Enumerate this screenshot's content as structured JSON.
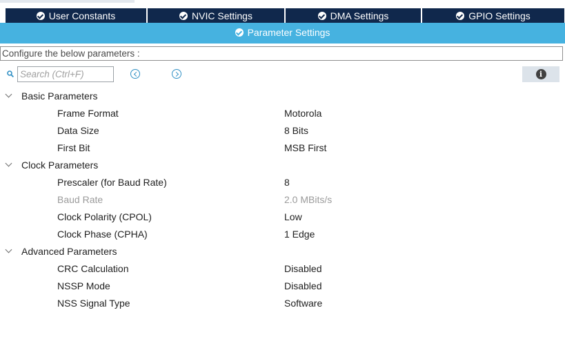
{
  "tabs": [
    {
      "label": "User Constants"
    },
    {
      "label": "NVIC Settings"
    },
    {
      "label": "DMA Settings"
    },
    {
      "label": "GPIO Settings"
    }
  ],
  "active_tab": {
    "label": "Parameter Settings"
  },
  "configure_text": "Configure the below parameters :",
  "search": {
    "placeholder": "Search (Ctrl+F)",
    "value": ""
  },
  "info_label": "i",
  "groups": [
    {
      "label": "Basic Parameters",
      "params": [
        {
          "label": "Frame Format",
          "value": "Motorola"
        },
        {
          "label": "Data Size",
          "value": "8 Bits"
        },
        {
          "label": "First Bit",
          "value": "MSB First"
        }
      ]
    },
    {
      "label": "Clock Parameters",
      "params": [
        {
          "label": "Prescaler (for Baud Rate)",
          "value": "8"
        },
        {
          "label": "Baud Rate",
          "value": "2.0 MBits/s"
        },
        {
          "label": "Clock Polarity (CPOL)",
          "value": "Low"
        },
        {
          "label": "Clock Phase (CPHA)",
          "value": "1 Edge"
        }
      ]
    },
    {
      "label": "Advanced Parameters",
      "params": [
        {
          "label": "CRC Calculation",
          "value": "Disabled"
        },
        {
          "label": "NSSP Mode",
          "value": "Disabled"
        },
        {
          "label": "NSS Signal Type",
          "value": "Software"
        }
      ]
    }
  ],
  "colors": {
    "tab_bg": "#10284c",
    "active_tab_bg": "#46b2e0",
    "disabled_text": "#9a9a9a"
  }
}
